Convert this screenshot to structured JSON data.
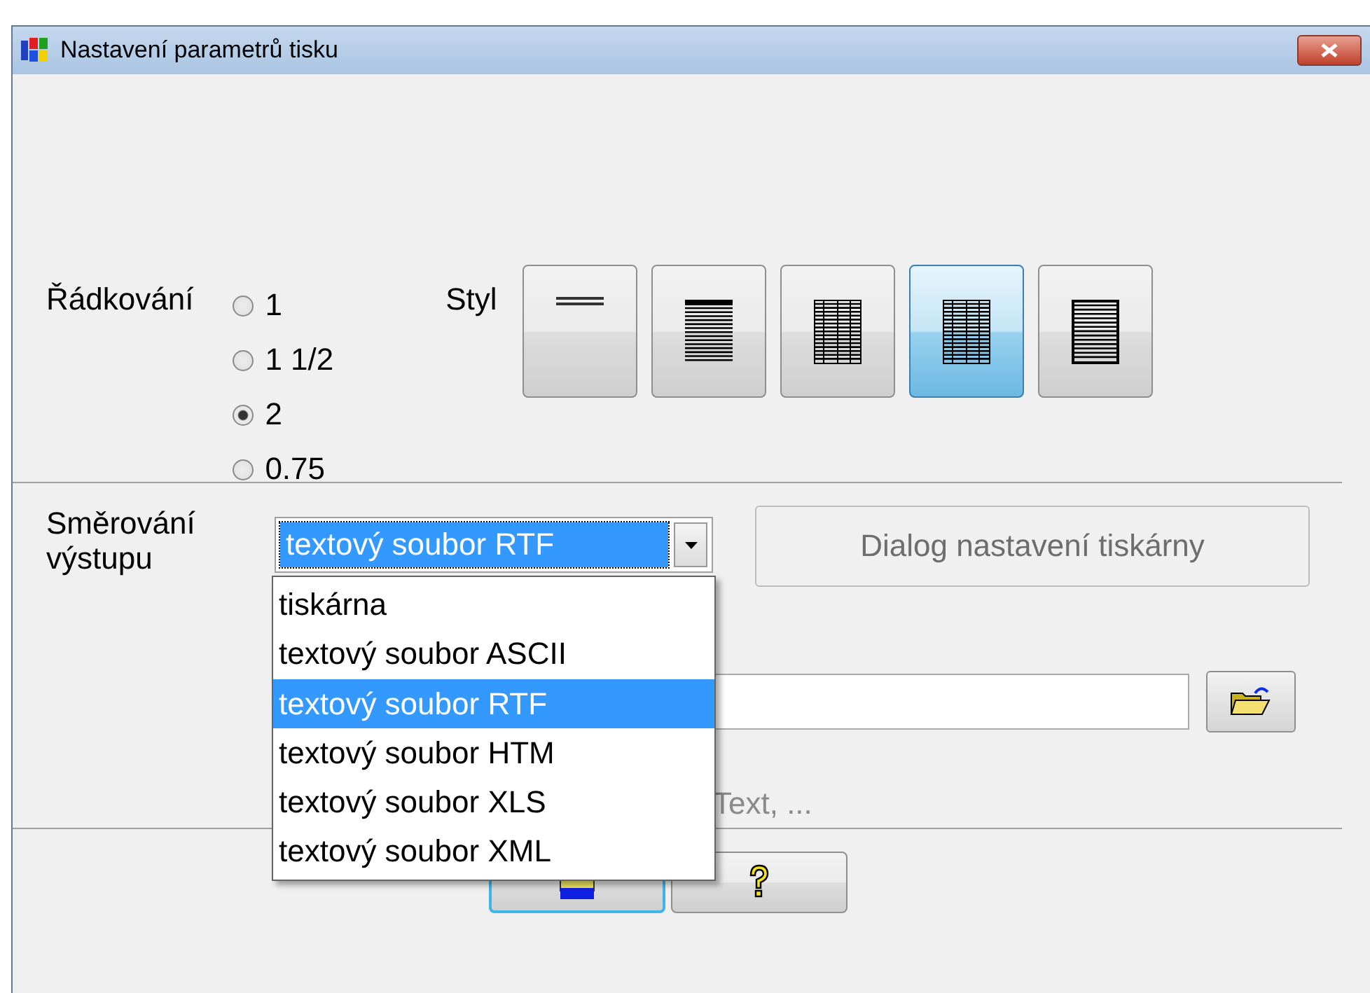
{
  "window": {
    "title": "Nastavení parametrů tisku"
  },
  "spacing": {
    "label": "Řádkování",
    "options": [
      {
        "label": "1",
        "selected": false
      },
      {
        "label": "1 1/2",
        "selected": false
      },
      {
        "label": "2",
        "selected": true
      },
      {
        "label": "0.75",
        "selected": false
      }
    ]
  },
  "style": {
    "label": "Styl",
    "buttons": [
      {
        "kind": "single-line",
        "selected": false
      },
      {
        "kind": "rows",
        "selected": false
      },
      {
        "kind": "grid",
        "selected": false
      },
      {
        "kind": "grid",
        "selected": true
      },
      {
        "kind": "framed-rows",
        "selected": false
      }
    ]
  },
  "output": {
    "label": "Směrování výstupu",
    "value": "textový soubor RTF",
    "expanded": true,
    "options": [
      {
        "label": "tiskárna",
        "selected": false
      },
      {
        "label": "textový soubor ASCII",
        "selected": false
      },
      {
        "label": "textový soubor RTF",
        "selected": true
      },
      {
        "label": "textový soubor HTM",
        "selected": false
      },
      {
        "label": "textový soubor XLS",
        "selected": false
      },
      {
        "label": "textový soubor XML",
        "selected": false
      }
    ],
    "printer_dialog_button": "Dialog nastavení tiskárny",
    "hint": "Text, ..."
  }
}
